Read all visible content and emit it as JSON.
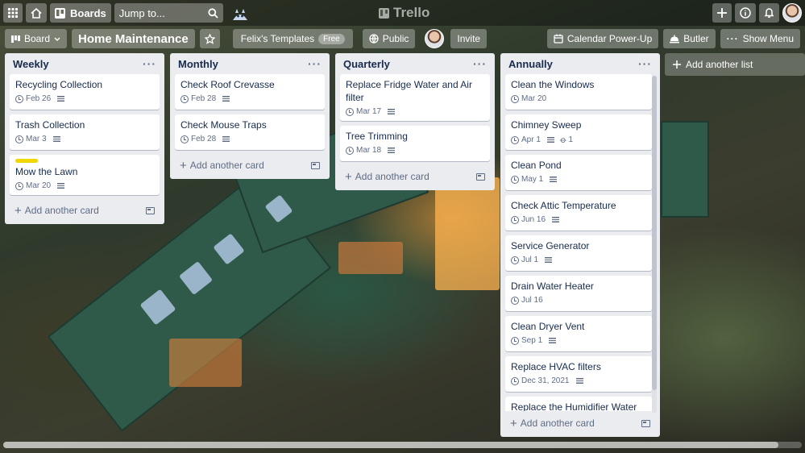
{
  "topbar": {
    "boards_label": "Boards",
    "search_placeholder": "Jump to...",
    "logo_text": "Trello"
  },
  "boardbar": {
    "view_label": "Board",
    "board_name": "Home Maintenance",
    "team_label": "Felix's Templates",
    "free_badge": "Free",
    "visibility_label": "Public",
    "invite_label": "Invite",
    "calendar_label": "Calendar Power-Up",
    "butler_label": "Butler",
    "menu_label": "Show Menu"
  },
  "lists": [
    {
      "title": "Weekly",
      "cards": [
        {
          "title": "Recycling Collection",
          "date": "Feb 26",
          "description": true
        },
        {
          "title": "Trash Collection",
          "date": "Mar 3",
          "description": true
        },
        {
          "title": "Mow the Lawn",
          "date": "Mar 20",
          "description": true,
          "label_color": "#f2d600"
        }
      ]
    },
    {
      "title": "Monthly",
      "cards": [
        {
          "title": "Check Roof Crevasse",
          "date": "Feb 28",
          "description": true
        },
        {
          "title": "Check Mouse Traps",
          "date": "Feb 28",
          "description": true
        }
      ]
    },
    {
      "title": "Quarterly",
      "cards": [
        {
          "title": "Replace Fridge Water and Air filter",
          "date": "Mar 17",
          "description": true
        },
        {
          "title": "Tree Trimming",
          "date": "Mar 18",
          "description": true
        }
      ]
    },
    {
      "title": "Annually",
      "cards": [
        {
          "title": "Clean the Windows",
          "date": "Mar 20",
          "description": false
        },
        {
          "title": "Chimney Sweep",
          "date": "Apr 1",
          "description": true,
          "attachments": "1"
        },
        {
          "title": "Clean Pond",
          "date": "May 1",
          "description": true
        },
        {
          "title": "Check Attic Temperature",
          "date": "Jun 16",
          "description": true
        },
        {
          "title": "Service Generator",
          "date": "Jul 1",
          "description": true
        },
        {
          "title": "Drain Water Heater",
          "date": "Jul 16",
          "description": false
        },
        {
          "title": "Clean Dryer Vent",
          "date": "Sep 1",
          "description": true
        },
        {
          "title": "Replace HVAC filters",
          "date": "Dec 31, 2021",
          "description": true
        },
        {
          "title": "Replace the Humidifier Water Panel"
        }
      ]
    }
  ],
  "add_card_label": "Add another card",
  "add_list_label": "Add another list"
}
